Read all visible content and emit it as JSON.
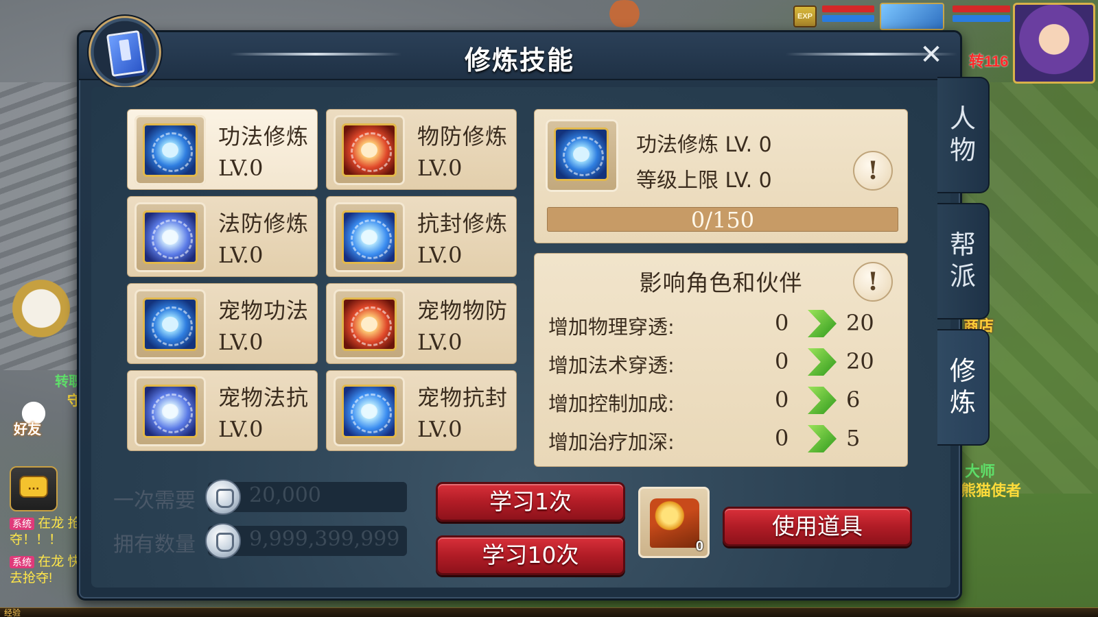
{
  "window": {
    "title": "修炼技能",
    "close_label": "✕"
  },
  "hud": {
    "exp_label": "EXP",
    "level_label": "转116",
    "shop_label": "商店",
    "npc_labels": [
      "转职",
      "守",
      "大师",
      "熊猫使者"
    ]
  },
  "left_hud": {
    "friend_label": "好友",
    "chat_icon": "…",
    "system_messages": [
      {
        "tag": "系统",
        "text": "在龙 抢夺！！！"
      },
      {
        "tag": "系统",
        "text": "在龙 快去抢夺!"
      }
    ],
    "exp_strip": "经验"
  },
  "skills": [
    {
      "name": "功法修炼",
      "level": "LV.0",
      "icon": "skill-gongfa-icon",
      "color": "blue",
      "selected": true
    },
    {
      "name": "物防修炼",
      "level": "LV.0",
      "icon": "skill-wufang-icon",
      "color": "red",
      "selected": false
    },
    {
      "name": "法防修炼",
      "level": "LV.0",
      "icon": "skill-fafang-icon",
      "color": "violet",
      "selected": false
    },
    {
      "name": "抗封修炼",
      "level": "LV.0",
      "icon": "skill-kangfeng-icon",
      "color": "sky",
      "selected": false
    },
    {
      "name": "宠物功法",
      "level": "LV.0",
      "icon": "pet-gongfa-icon",
      "color": "blue",
      "selected": false
    },
    {
      "name": "宠物物防",
      "level": "LV.0",
      "icon": "pet-wufang-icon",
      "color": "red",
      "selected": false
    },
    {
      "name": "宠物法抗",
      "level": "LV.0",
      "icon": "pet-fakang-icon",
      "color": "violet",
      "selected": false
    },
    {
      "name": "宠物抗封",
      "level": "LV.0",
      "icon": "pet-kangfeng-icon",
      "color": "sky",
      "selected": false
    }
  ],
  "detail": {
    "name_line": "功法修炼 LV. 0",
    "cap_line": "等级上限 LV. 0",
    "info_icon": "!",
    "progress_text": "0/150",
    "progress_current": 0,
    "progress_max": 150
  },
  "effects": {
    "title": "影响角色和伙伴",
    "info_icon": "!",
    "rows": [
      {
        "label": "增加物理穿透:",
        "current": "0",
        "next": "20"
      },
      {
        "label": "增加法术穿透:",
        "current": "0",
        "next": "20"
      },
      {
        "label": "增加控制加成:",
        "current": "0",
        "next": "6"
      },
      {
        "label": "增加治疗加深:",
        "current": "0",
        "next": "5"
      }
    ]
  },
  "cost": {
    "need_label": "一次需要",
    "need_value": "20,000",
    "own_label": "拥有数量",
    "own_value": "9,999,399,999"
  },
  "buttons": {
    "learn_once": "学习1次",
    "learn_ten": "学习10次",
    "use_item": "使用道具"
  },
  "item_slot": {
    "count": "0"
  },
  "side_tabs": [
    {
      "label": "人物",
      "active": false
    },
    {
      "label": "帮派",
      "active": false
    },
    {
      "label": "修炼",
      "active": true
    }
  ],
  "colors": {
    "panel_bg": "#23374a",
    "card_bg": "#e3cfac",
    "button_red": "#b11c26",
    "arrow_green": "#2f9a1c"
  }
}
